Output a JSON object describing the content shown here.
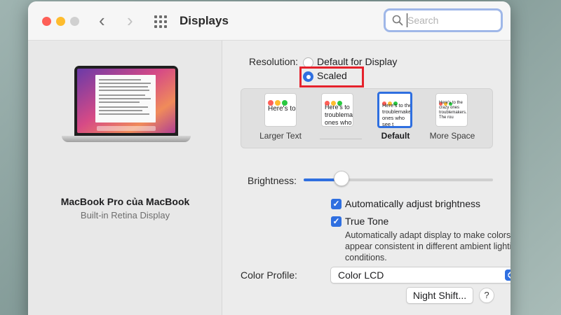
{
  "window": {
    "title": "Displays"
  },
  "toolbar": {
    "back_icon": "chevron-left-icon",
    "forward_icon": "chevron-right-icon",
    "grid_icon": "grid-icon"
  },
  "search": {
    "placeholder": "Search",
    "value": ""
  },
  "device": {
    "name": "MacBook Pro của MacBook",
    "subtitle": "Built-in Retina Display"
  },
  "resolution": {
    "label": "Resolution:",
    "options": [
      {
        "label": "Default for Display",
        "selected": false
      },
      {
        "label": "Scaled",
        "selected": true
      }
    ]
  },
  "scale_options": [
    {
      "label": "Larger Text",
      "preview_text": "Here's to troublem",
      "selected": false
    },
    {
      "label": "",
      "preview_text": "Here's to troublemak ones who",
      "selected": false
    },
    {
      "label": "Default",
      "preview_text": "Here's to the troublemakers. ones who see t",
      "selected": true
    },
    {
      "label": "More Space",
      "preview_text": "Here's to the crazy ones troublemakers. The rou",
      "selected": false
    }
  ],
  "brightness": {
    "label": "Brightness:",
    "value": 0.2
  },
  "auto_brightness": {
    "label": "Automatically adjust brightness",
    "checked": true
  },
  "true_tone": {
    "label": "True Tone",
    "checked": true,
    "description": "Automatically adapt display to make colors appear consistent in different ambient lighting conditions."
  },
  "color_profile": {
    "label": "Color Profile:",
    "value": "Color LCD"
  },
  "night_shift": {
    "label": "Night Shift..."
  },
  "help": {
    "label": "?"
  },
  "colors": {
    "accent": "#2f6fe0",
    "highlight": "#e5222c"
  }
}
